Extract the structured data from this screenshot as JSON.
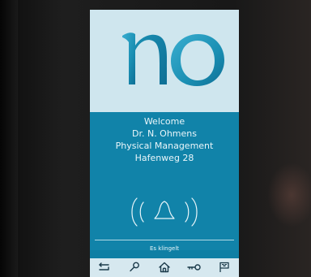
{
  "logo": {
    "text": "no",
    "colors": [
      "#1a8fb3",
      "#0e6f95",
      "#3aaed0"
    ]
  },
  "welcome": {
    "lines": [
      "Welcome",
      "Dr. N. Ohmens",
      "Physical Management",
      "Hafenweg 28"
    ]
  },
  "bell_icon": "ringing-bell-icon",
  "status": {
    "text": "Es klingelt"
  },
  "navbar": {
    "items": [
      {
        "icon": "back-icon"
      },
      {
        "icon": "search-icon"
      },
      {
        "icon": "home-icon"
      },
      {
        "icon": "key-icon"
      },
      {
        "icon": "flag-icon"
      }
    ]
  },
  "colors": {
    "logo_background": "#cfe6ee",
    "main_background": "#1183a9",
    "text": "#eaf6fa",
    "navbar_background": "#d6e8ef",
    "navbar_icons": "#1a3a4a"
  }
}
